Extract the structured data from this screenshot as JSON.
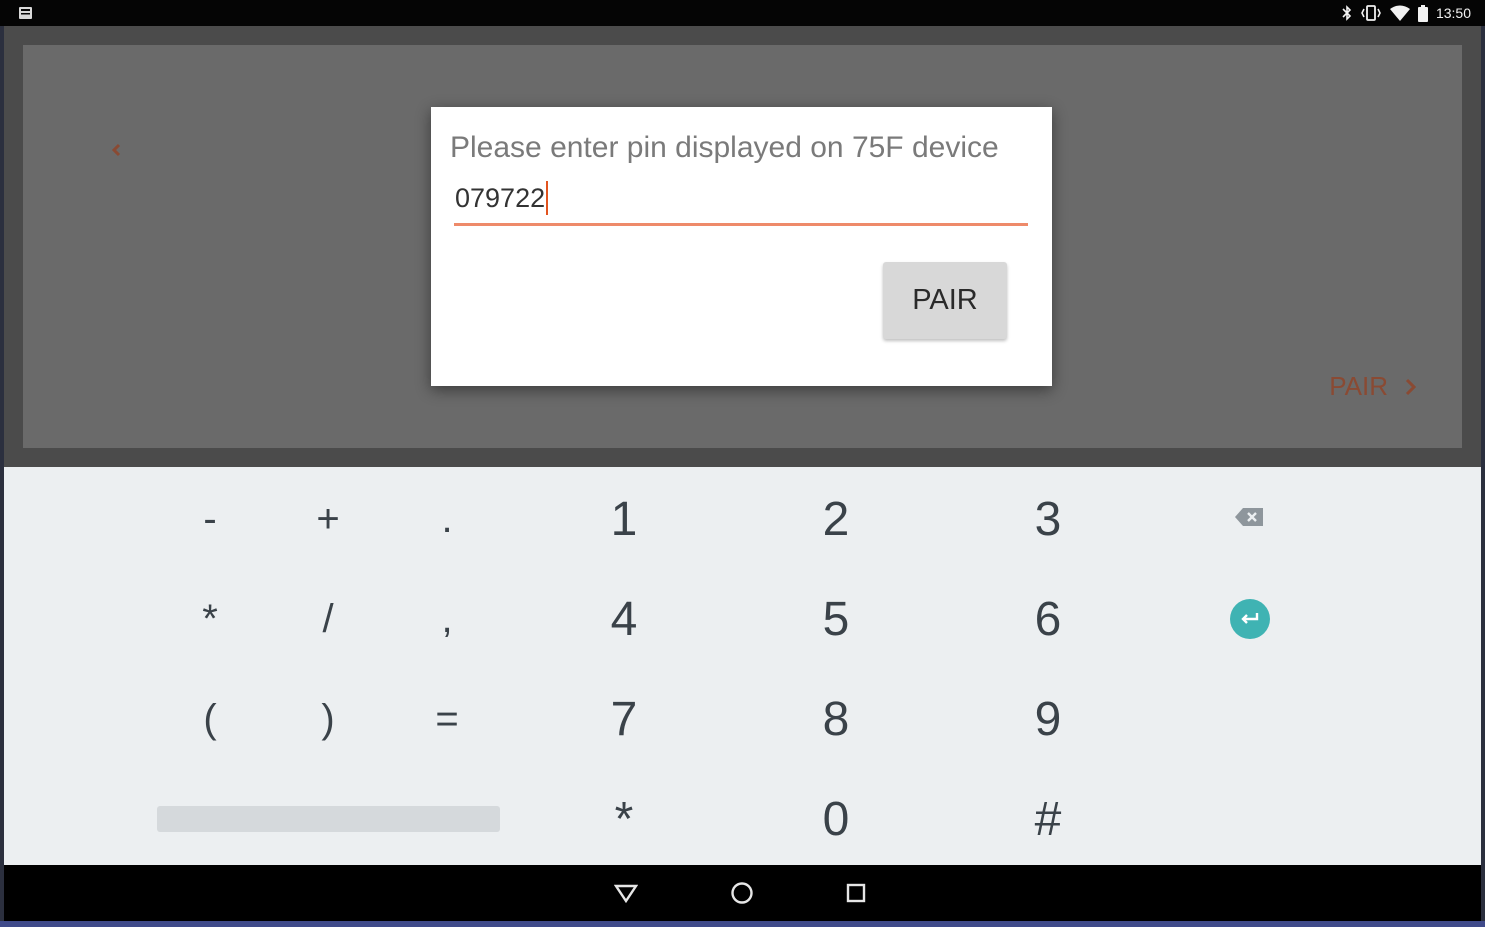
{
  "status_bar": {
    "time": "13:50",
    "icons": [
      "notification-icon",
      "bluetooth-icon",
      "vibrate-icon",
      "wifi-icon",
      "battery-icon"
    ]
  },
  "app": {
    "next_label": "PAIR",
    "accent_color": "#8a4a33"
  },
  "dialog": {
    "title": "Please enter pin displayed on 75F device",
    "pin_value": "079722",
    "button_label": "PAIR",
    "underline_color": "#ee8a6a"
  },
  "keyboard": {
    "rows": [
      [
        "-",
        "+",
        ".",
        "1",
        "2",
        "3",
        "backspace-icon"
      ],
      [
        "*",
        "/",
        ",",
        "4",
        "5",
        "6",
        "enter-icon"
      ],
      [
        "(",
        ")",
        "=",
        "7",
        "8",
        "9"
      ],
      [
        "space",
        "*",
        "0",
        "#"
      ]
    ],
    "enter_color": "#3fb3b3"
  },
  "nav_bar": {
    "buttons": [
      "back-icon",
      "home-icon",
      "recents-icon"
    ]
  }
}
